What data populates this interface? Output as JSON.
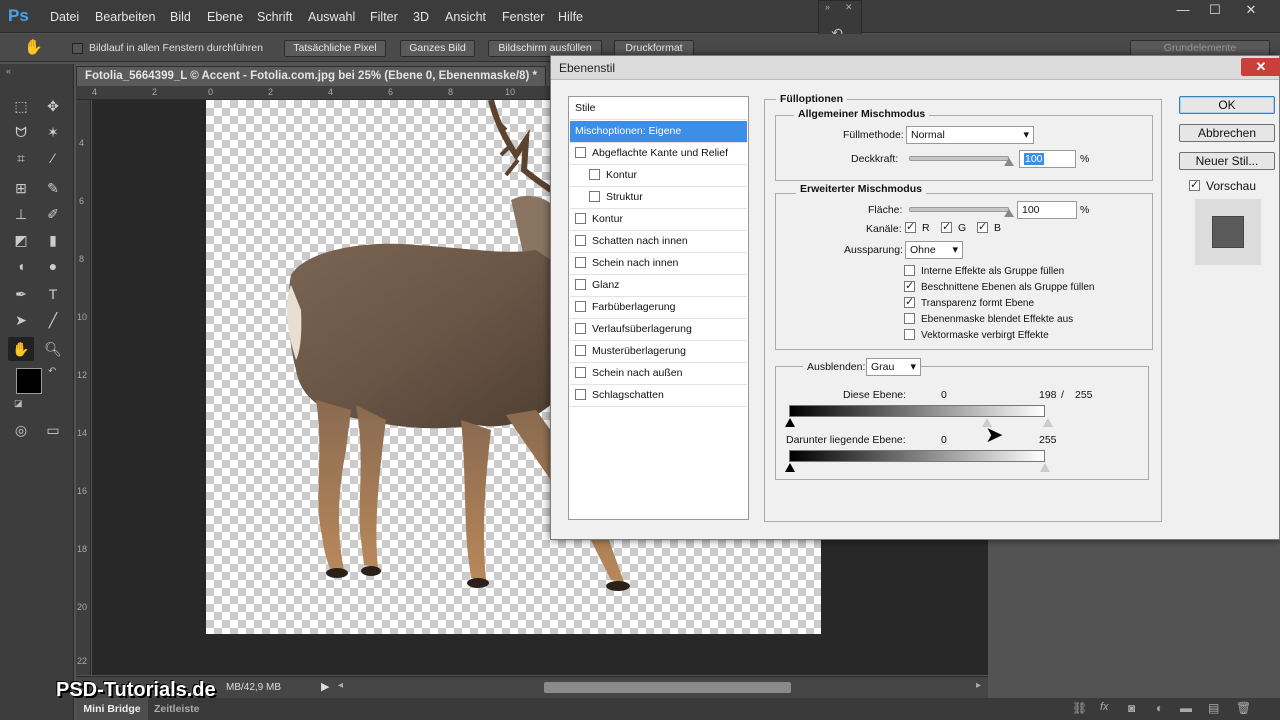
{
  "menubar": {
    "logo": "Ps",
    "items": [
      "Datei",
      "Bearbeiten",
      "Bild",
      "Ebene",
      "Schrift",
      "Auswahl",
      "Filter",
      "3D",
      "Ansicht",
      "Fenster",
      "Hilfe"
    ]
  },
  "options": {
    "scroll_all_label": "Bildlauf in allen Fenstern durchführen",
    "btn_actual": "Tatsächliche Pixel",
    "btn_fit": "Ganzes Bild",
    "btn_fill": "Bildschirm ausfüllen",
    "btn_print": "Druckformat",
    "workspace": "Grundelemente"
  },
  "document": {
    "tab_title": "Fotolia_5664399_L © Accent - Fotolia.com.jpg bei 25% (Ebene 0, Ebenenmaske/8) *",
    "status": "MB/42,9 MB",
    "ruler_h": [
      "4",
      "2",
      "0",
      "2",
      "4",
      "6",
      "8",
      "10"
    ],
    "ruler_v": [
      "4",
      "6",
      "8",
      "10",
      "12",
      "14",
      "16",
      "18",
      "20",
      "22"
    ]
  },
  "dialog": {
    "title": "Ebenenstil",
    "styles_header": "Stile",
    "styles": [
      {
        "label": "Mischoptionen: Eigene",
        "selected": true,
        "checkbox": false,
        "indent": false,
        "checked": false
      },
      {
        "label": "Abgeflachte Kante und Relief",
        "checkbox": true,
        "indent": false,
        "checked": false
      },
      {
        "label": "Kontur",
        "checkbox": true,
        "indent": true,
        "checked": false
      },
      {
        "label": "Struktur",
        "checkbox": true,
        "indent": true,
        "checked": false
      },
      {
        "label": "Kontur",
        "checkbox": true,
        "indent": false,
        "checked": false
      },
      {
        "label": "Schatten nach innen",
        "checkbox": true,
        "indent": false,
        "checked": false
      },
      {
        "label": "Schein nach innen",
        "checkbox": true,
        "indent": false,
        "checked": false
      },
      {
        "label": "Glanz",
        "checkbox": true,
        "indent": false,
        "checked": false
      },
      {
        "label": "Farbüberlagerung",
        "checkbox": true,
        "indent": false,
        "checked": false
      },
      {
        "label": "Verlaufsüberlagerung",
        "checkbox": true,
        "indent": false,
        "checked": false
      },
      {
        "label": "Musterüberlagerung",
        "checkbox": true,
        "indent": false,
        "checked": false
      },
      {
        "label": "Schein nach außen",
        "checkbox": true,
        "indent": false,
        "checked": false
      },
      {
        "label": "Schlagschatten",
        "checkbox": true,
        "indent": false,
        "checked": false
      }
    ],
    "fill_options_title": "Fülloptionen",
    "general_blend_title": "Allgemeiner Mischmodus",
    "blend_mode_label": "Füllmethode:",
    "blend_mode_value": "Normal",
    "opacity_label": "Deckkraft:",
    "opacity_value": "100",
    "opacity_level": 1.0,
    "percent": "%",
    "advanced_title": "Erweiterter Mischmodus",
    "fill_label": "Fläche:",
    "fill_value": "100",
    "fill_level": 1.0,
    "channels_label": "Kanäle:",
    "channels": [
      "R",
      "G",
      "B"
    ],
    "knockout_label": "Aussparung:",
    "knockout_value": "Ohne",
    "adv_options": [
      {
        "label": "Interne Effekte als Gruppe füllen",
        "checked": false
      },
      {
        "label": "Beschnittene Ebenen als Gruppe füllen",
        "checked": true
      },
      {
        "label": "Transparenz formt Ebene",
        "checked": true
      },
      {
        "label": "Ebenenmaske blendet Effekte aus",
        "checked": false
      },
      {
        "label": "Vektormaske verbirgt Effekte",
        "checked": false
      }
    ],
    "blend_if_label": "Ausblenden:",
    "blend_if_value": "Grau",
    "this_layer_label": "Diese Ebene:",
    "this_layer_low": "0",
    "this_layer_high": "198",
    "slash": "/",
    "this_layer_high2": "255",
    "underlying_label": "Darunter liegende Ebene:",
    "underlying_low": "0",
    "underlying_high": "255",
    "ok": "OK",
    "cancel": "Abbrechen",
    "new_style": "Neuer Stil...",
    "preview": "Vorschau"
  },
  "bottom": {
    "tab1": "Mini Bridge",
    "tab2": "Zeitleiste"
  },
  "watermark": "PSD-Tutorials.de"
}
